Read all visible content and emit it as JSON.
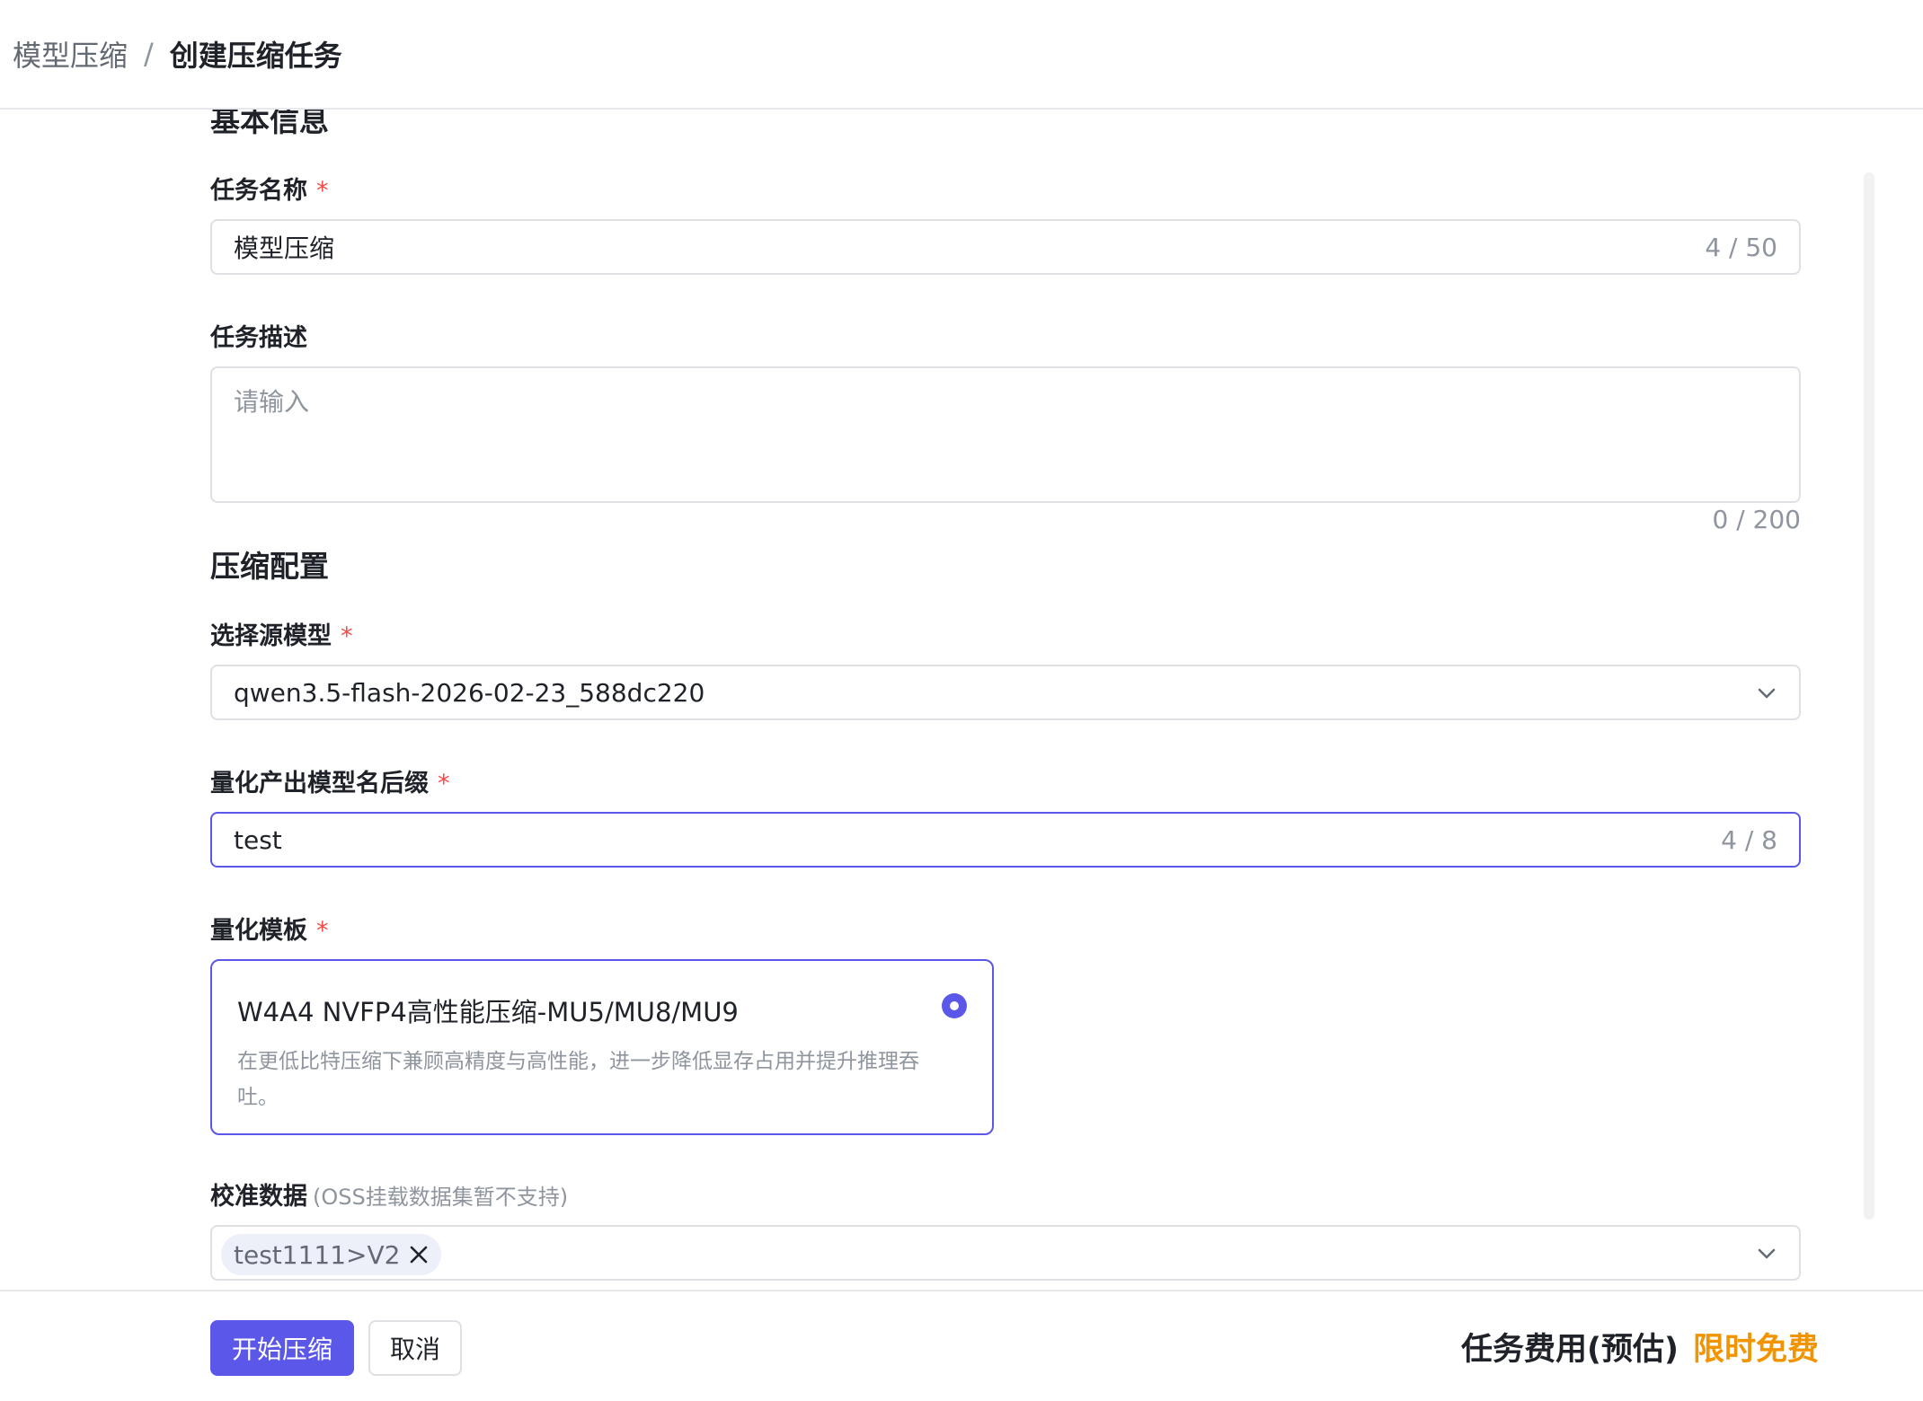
{
  "breadcrumb": {
    "parent": "模型压缩",
    "separator": "/",
    "current": "创建压缩任务"
  },
  "basic_info": {
    "section_title": "基本信息",
    "task_name": {
      "label": "任务名称",
      "required": "*",
      "value": "模型压缩",
      "count": "4 / 50"
    },
    "task_desc": {
      "label": "任务描述",
      "placeholder": "请输入",
      "count": "0 / 200"
    }
  },
  "compress_config": {
    "section_title": "压缩配置",
    "source_model": {
      "label": "选择源模型",
      "required": "*",
      "value": "qwen3.5-flash-2026-02-23_588dc220"
    },
    "suffix": {
      "label": "量化产出模型名后缀",
      "required": "*",
      "value": "test",
      "count": "4 / 8"
    },
    "template": {
      "label": "量化模板",
      "required": "*",
      "card_title": "W4A4 NVFP4高性能压缩-MU5/MU8/MU9",
      "card_desc": "在更低比特压缩下兼顾高精度与高性能，进一步降低显存占用并提升推理吞吐。",
      "selected": true
    },
    "calibration": {
      "label": "校准数据",
      "hint": "(OSS挂载数据集暂不支持)",
      "tags": [
        "test1111>V2"
      ]
    }
  },
  "footer": {
    "start_label": "开始压缩",
    "cancel_label": "取消",
    "cost_label": "任务费用(预估)",
    "cost_value": "限时免费"
  },
  "colors": {
    "accent": "#5b57e8",
    "required": "#f54a45",
    "free": "#f29400"
  }
}
